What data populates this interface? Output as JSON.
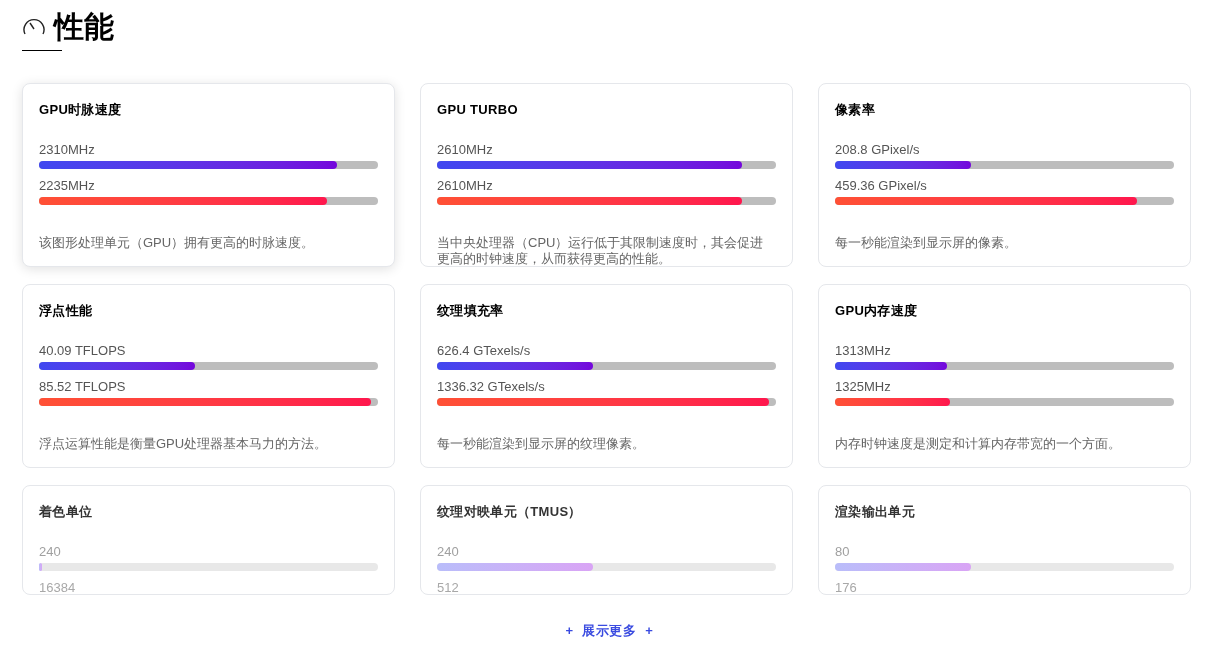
{
  "page": {
    "title": "性能"
  },
  "cards": [
    {
      "title": "GPU时脉速度",
      "highlighted": true,
      "readings": [
        {
          "value": "2310MHz",
          "level": 0.88
        },
        {
          "value": "2235MHz",
          "level": 0.85
        }
      ],
      "description": "该图形处理单元（GPU）拥有更高的时脉速度。"
    },
    {
      "title": "GPU TURBO",
      "highlighted": false,
      "readings": [
        {
          "value": "2610MHz",
          "level": 0.9
        },
        {
          "value": "2610MHz",
          "level": 0.9
        }
      ],
      "description": "当中央处理器（CPU）运行低于其限制速度时，其会促进更高的时钟速度，从而获得更高的性能。"
    },
    {
      "title": "像素率",
      "highlighted": false,
      "readings": [
        {
          "value": "208.8 GPixel/s",
          "level": 0.4
        },
        {
          "value": "459.36 GPixel/s",
          "level": 0.89
        }
      ],
      "description": "每一秒能渲染到显示屏的像素。"
    },
    {
      "title": "浮点性能",
      "highlighted": false,
      "readings": [
        {
          "value": "40.09 TFLOPS",
          "level": 0.46
        },
        {
          "value": "85.52 TFLOPS",
          "level": 0.98
        }
      ],
      "description": "浮点运算性能是衡量GPU处理器基本马力的方法。"
    },
    {
      "title": "纹理填充率",
      "highlighted": false,
      "readings": [
        {
          "value": "626.4 GTexels/s",
          "level": 0.46
        },
        {
          "value": "1336.32 GTexels/s",
          "level": 0.98
        }
      ],
      "description": "每一秒能渲染到显示屏的纹理像素。"
    },
    {
      "title": "GPU内存速度",
      "highlighted": false,
      "readings": [
        {
          "value": "1313MHz",
          "level": 0.33
        },
        {
          "value": "1325MHz",
          "level": 0.34
        }
      ],
      "description": "内存时钟速度是测定和计算内存带宽的一个方面。"
    },
    {
      "title": "着色单位",
      "highlighted": false,
      "readings": [
        {
          "value": "240",
          "level": 0.01
        },
        {
          "value": "16384"
        }
      ]
    },
    {
      "title": "纹理对映单元（TMUS）",
      "highlighted": false,
      "readings": [
        {
          "value": "240",
          "level": 0.46
        },
        {
          "value": "512"
        }
      ]
    },
    {
      "title": "渲染输出单元",
      "highlighted": false,
      "readings": [
        {
          "value": "80",
          "level": 0.4
        },
        {
          "value": "176"
        }
      ]
    }
  ],
  "collapsed": true,
  "more_button": {
    "label": "+  展示更多  +"
  }
}
